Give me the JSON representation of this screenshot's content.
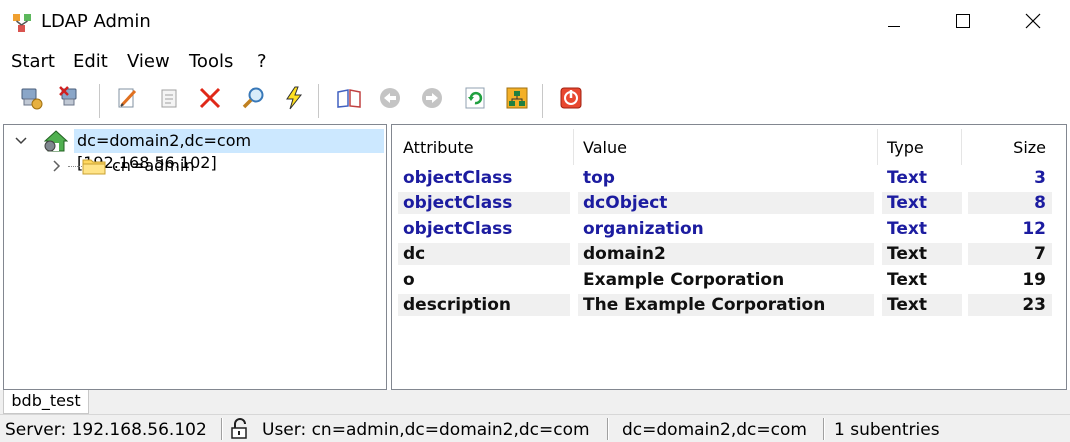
{
  "window": {
    "title": "LDAP Admin",
    "icons": {
      "app": "ldap-admin-app-icon",
      "minimize": "minimize-icon",
      "maximize": "maximize-icon",
      "close": "close-icon"
    }
  },
  "menu": [
    {
      "label": "Start"
    },
    {
      "label": "Edit"
    },
    {
      "label": "View"
    },
    {
      "label": "Tools"
    },
    {
      "label": "?"
    }
  ],
  "toolbar": {
    "buttons": [
      "connect-icon",
      "disconnect-icon",
      "edit-entry-icon",
      "properties-icon",
      "delete-icon",
      "search-icon",
      "lightning-icon",
      "schema-book-icon",
      "back-icon",
      "forward-icon",
      "refresh-icon",
      "tree-icon",
      "exit-icon"
    ]
  },
  "tree": {
    "root": {
      "label": "dc=domain2,dc=com [192.168.56.102]",
      "icon": "server-root-icon",
      "expanded": true,
      "selected": true
    },
    "children": [
      {
        "label": "cn=admin",
        "icon": "folder-icon",
        "expanded": false
      }
    ]
  },
  "table": {
    "headers": {
      "attribute": "Attribute",
      "value": "Value",
      "type": "Type",
      "size": "Size"
    },
    "rows": [
      {
        "attribute": "objectClass",
        "value": "top",
        "type": "Text",
        "size": "3"
      },
      {
        "attribute": "objectClass",
        "value": "dcObject",
        "type": "Text",
        "size": "8"
      },
      {
        "attribute": "objectClass",
        "value": "organization",
        "type": "Text",
        "size": "12"
      },
      {
        "attribute": "dc",
        "value": "domain2",
        "type": "Text",
        "size": "7"
      },
      {
        "attribute": "o",
        "value": "Example Corporation",
        "type": "Text",
        "size": "19"
      },
      {
        "attribute": "description",
        "value": "The Example Corporation",
        "type": "Text",
        "size": "23"
      }
    ],
    "colors": {
      "objectclass_rows": "#1c1ca0",
      "other_rows": "#101010"
    }
  },
  "tabs": [
    {
      "label": "bdb_test"
    }
  ],
  "status": {
    "server": "Server: 192.168.56.102",
    "user": "User: cn=admin,dc=domain2,dc=com",
    "dn": "dc=domain2,dc=com",
    "subentries": "1 subentries"
  }
}
